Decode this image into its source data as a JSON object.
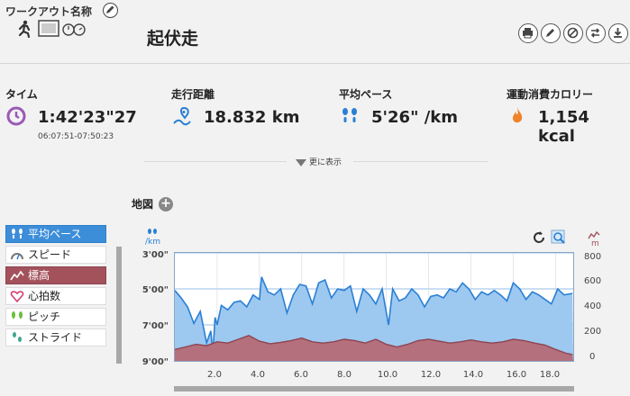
{
  "header": {
    "workout_name_label": "ワークアウト名称",
    "title": "起伏走"
  },
  "metrics": [
    {
      "label": "タイム",
      "value": "1:42'23\"27",
      "sub": "06:07:51-07:50:23",
      "icon": "clock-icon"
    },
    {
      "label": "走行距離",
      "value": "18.832 km",
      "icon": "route-pin-icon"
    },
    {
      "label": "平均ペース",
      "value": "5'26\" /km",
      "icon": "footprints-icon"
    },
    {
      "label": "運動消費カロリー",
      "value": "1,154 kcal",
      "icon": "flame-icon"
    }
  ],
  "more_label": "更に表示",
  "map_label": "地図",
  "legend": [
    {
      "label": "平均ペース",
      "state": "selected-blue",
      "icon": "footprints-icon"
    },
    {
      "label": "スピード",
      "state": "off",
      "icon": "speedometer-icon"
    },
    {
      "label": "標高",
      "state": "selected-red",
      "icon": "elevation-icon"
    },
    {
      "label": "心拍数",
      "state": "off",
      "icon": "heart-icon"
    },
    {
      "label": "ピッチ",
      "state": "off",
      "icon": "footprints-icon"
    },
    {
      "label": "ストライド",
      "state": "off",
      "icon": "stride-icon"
    }
  ],
  "chart_data": {
    "type": "area",
    "x_label": "",
    "x_unit": "km",
    "x_ticks": [
      "2.0",
      "4.0",
      "6.0",
      "8.0",
      "10.0",
      "12.0",
      "14.0",
      "16.0",
      "18.0"
    ],
    "x_range": [
      0,
      18.832
    ],
    "left_axis": {
      "unit": "/km",
      "ticks": [
        "3'00\"",
        "5'00\"",
        "7'00\"",
        "9'00\""
      ],
      "range_sec": [
        180,
        540
      ],
      "inverted": true
    },
    "right_axis": {
      "unit": "m",
      "ticks": [
        "800",
        "600",
        "400",
        "200",
        "0"
      ],
      "range": [
        -50,
        800
      ]
    },
    "series": [
      {
        "name": "平均ペース",
        "color": "#2a7fd4",
        "fill": "#9dc8f0",
        "x": [
          0,
          0.3,
          0.6,
          0.9,
          1.2,
          1.5,
          1.7,
          1.8,
          1.9,
          2.0,
          2.2,
          2.5,
          2.8,
          3.1,
          3.4,
          3.7,
          4.0,
          4.1,
          4.4,
          4.7,
          5.0,
          5.3,
          5.6,
          5.9,
          6.2,
          6.5,
          6.8,
          7.1,
          7.4,
          7.7,
          8.0,
          8.3,
          8.6,
          8.9,
          9.2,
          9.5,
          9.8,
          10.1,
          10.3,
          10.6,
          10.9,
          11.2,
          11.5,
          11.8,
          12.1,
          12.4,
          12.7,
          13.0,
          13.3,
          13.6,
          13.9,
          14.2,
          14.5,
          14.8,
          15.1,
          15.4,
          15.7,
          16.0,
          16.3,
          16.6,
          16.9,
          17.2,
          17.5,
          17.8,
          18.1,
          18.4,
          18.8
        ],
        "pace_sec": [
          305,
          330,
          360,
          415,
          375,
          480,
          440,
          515,
          395,
          420,
          355,
          370,
          345,
          340,
          360,
          320,
          335,
          260,
          310,
          320,
          300,
          380,
          320,
          285,
          290,
          350,
          280,
          270,
          330,
          300,
          305,
          290,
          375,
          300,
          320,
          350,
          300,
          420,
          300,
          340,
          330,
          300,
          320,
          360,
          325,
          320,
          330,
          300,
          310,
          280,
          300,
          335,
          310,
          320,
          305,
          320,
          340,
          280,
          300,
          335,
          310,
          320,
          335,
          350,
          300,
          320,
          315
        ]
      },
      {
        "name": "標高",
        "color": "#8e4450",
        "fill": "#b4707c",
        "x": [
          0,
          0.5,
          1.0,
          1.5,
          2.0,
          2.5,
          3.0,
          3.5,
          4.0,
          4.5,
          5.0,
          5.5,
          6.0,
          6.5,
          7.0,
          7.5,
          8.0,
          8.5,
          9.0,
          9.5,
          10.0,
          10.5,
          11.0,
          11.5,
          12.0,
          12.5,
          13.0,
          13.5,
          14.0,
          14.5,
          15.0,
          15.5,
          16.0,
          16.5,
          17.0,
          17.5,
          18.0,
          18.5,
          18.8
        ],
        "elevation_m": [
          40,
          60,
          80,
          70,
          100,
          90,
          120,
          150,
          105,
          85,
          95,
          110,
          130,
          100,
          90,
          100,
          120,
          110,
          90,
          120,
          80,
          60,
          80,
          110,
          120,
          105,
          90,
          100,
          115,
          100,
          90,
          100,
          120,
          110,
          90,
          75,
          40,
          10,
          0
        ]
      }
    ]
  }
}
